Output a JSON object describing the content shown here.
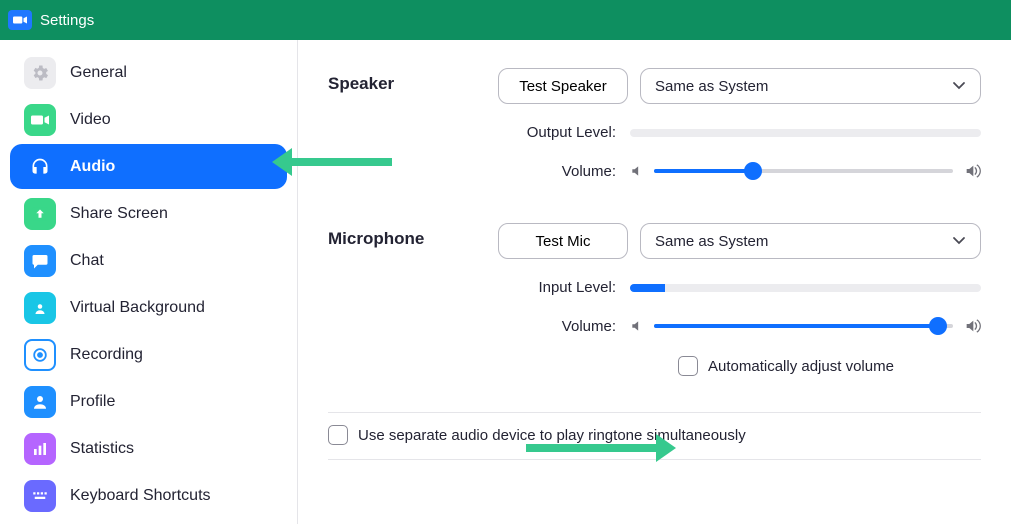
{
  "titlebar": {
    "title": "Settings"
  },
  "sidebar": {
    "items": [
      {
        "label": "General"
      },
      {
        "label": "Video"
      },
      {
        "label": "Audio"
      },
      {
        "label": "Share Screen"
      },
      {
        "label": "Chat"
      },
      {
        "label": "Virtual Background"
      },
      {
        "label": "Recording"
      },
      {
        "label": "Profile"
      },
      {
        "label": "Statistics"
      },
      {
        "label": "Keyboard Shortcuts"
      }
    ]
  },
  "audio": {
    "speaker": {
      "title": "Speaker",
      "test_label": "Test Speaker",
      "device": "Same as System",
      "output_label": "Output Level:",
      "volume_label": "Volume:",
      "volume_percent": 33
    },
    "microphone": {
      "title": "Microphone",
      "test_label": "Test Mic",
      "device": "Same as System",
      "input_label": "Input Level:",
      "input_percent": 10,
      "volume_label": "Volume:",
      "volume_percent": 95,
      "auto_adjust_label": "Automatically adjust volume"
    },
    "ringtone_label": "Use separate audio device to play ringtone simultaneously"
  },
  "colors": {
    "accent": "#0f6fff",
    "brand_green": "#0e8f60",
    "arrow_green": "#36c98e"
  }
}
